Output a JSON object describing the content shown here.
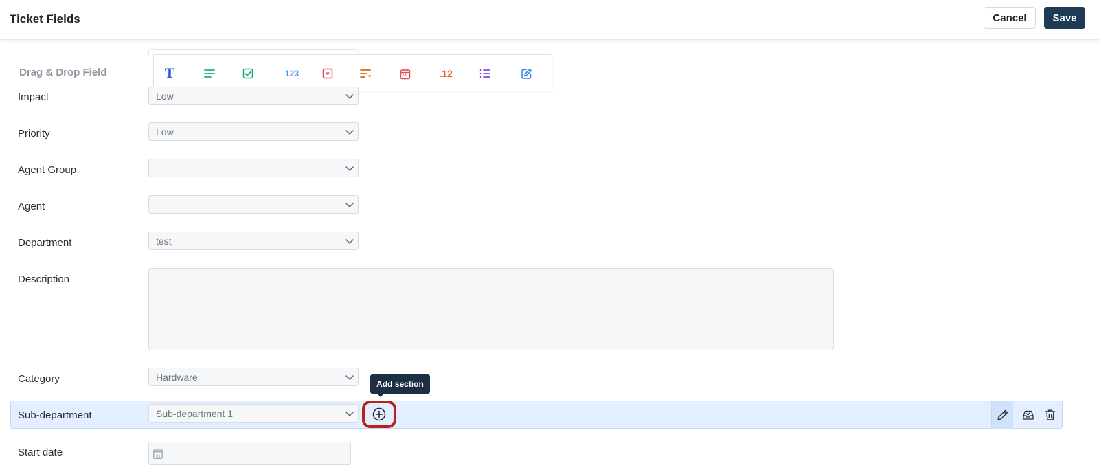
{
  "header": {
    "title": "Ticket Fields",
    "cancel_label": "Cancel",
    "save_label": "Save"
  },
  "toolbar": {
    "label": "Drag & Drop Field",
    "tools": [
      {
        "icon": "text-field-icon",
        "color": "#2d5bd8",
        "glyph": "T"
      },
      {
        "icon": "paragraph-field-icon",
        "color": "#1fb08a"
      },
      {
        "icon": "checkbox-field-icon",
        "color": "#1ea37a"
      },
      {
        "icon": "number-field-icon",
        "color": "#3d8ef0",
        "glyph": "123"
      },
      {
        "icon": "dropdown-field-icon",
        "color": "#e04646"
      },
      {
        "icon": "dependent-field-icon",
        "color": "#d36b16"
      },
      {
        "icon": "date-field-icon",
        "color": "#e05252",
        "glyph": "23"
      },
      {
        "icon": "decimal-field-icon",
        "color": "#d9641a",
        "glyph": ".12"
      },
      {
        "icon": "multi-select-field-icon",
        "color": "#8b44f0"
      },
      {
        "icon": "edit-field-icon",
        "color": "#2f7fe8"
      }
    ]
  },
  "fields": {
    "impact": {
      "label": "Impact",
      "value": "Low"
    },
    "priority": {
      "label": "Priority",
      "value": "Low"
    },
    "agent_group": {
      "label": "Agent Group",
      "value": ""
    },
    "agent": {
      "label": "Agent",
      "value": ""
    },
    "department": {
      "label": "Department",
      "value": "test"
    },
    "description": {
      "label": "Description"
    },
    "category": {
      "label": "Category",
      "value": "Hardware"
    },
    "sub_department": {
      "label": "Sub-department",
      "value": "Sub-department 1"
    },
    "start_date": {
      "label": "Start date",
      "calendar_glyph": "31"
    }
  },
  "tooltip": {
    "text": "Add section"
  },
  "colors": {
    "accent": "#1e3a55",
    "highlight_row": "#e3efff",
    "focus_ring": "#b3251b"
  }
}
